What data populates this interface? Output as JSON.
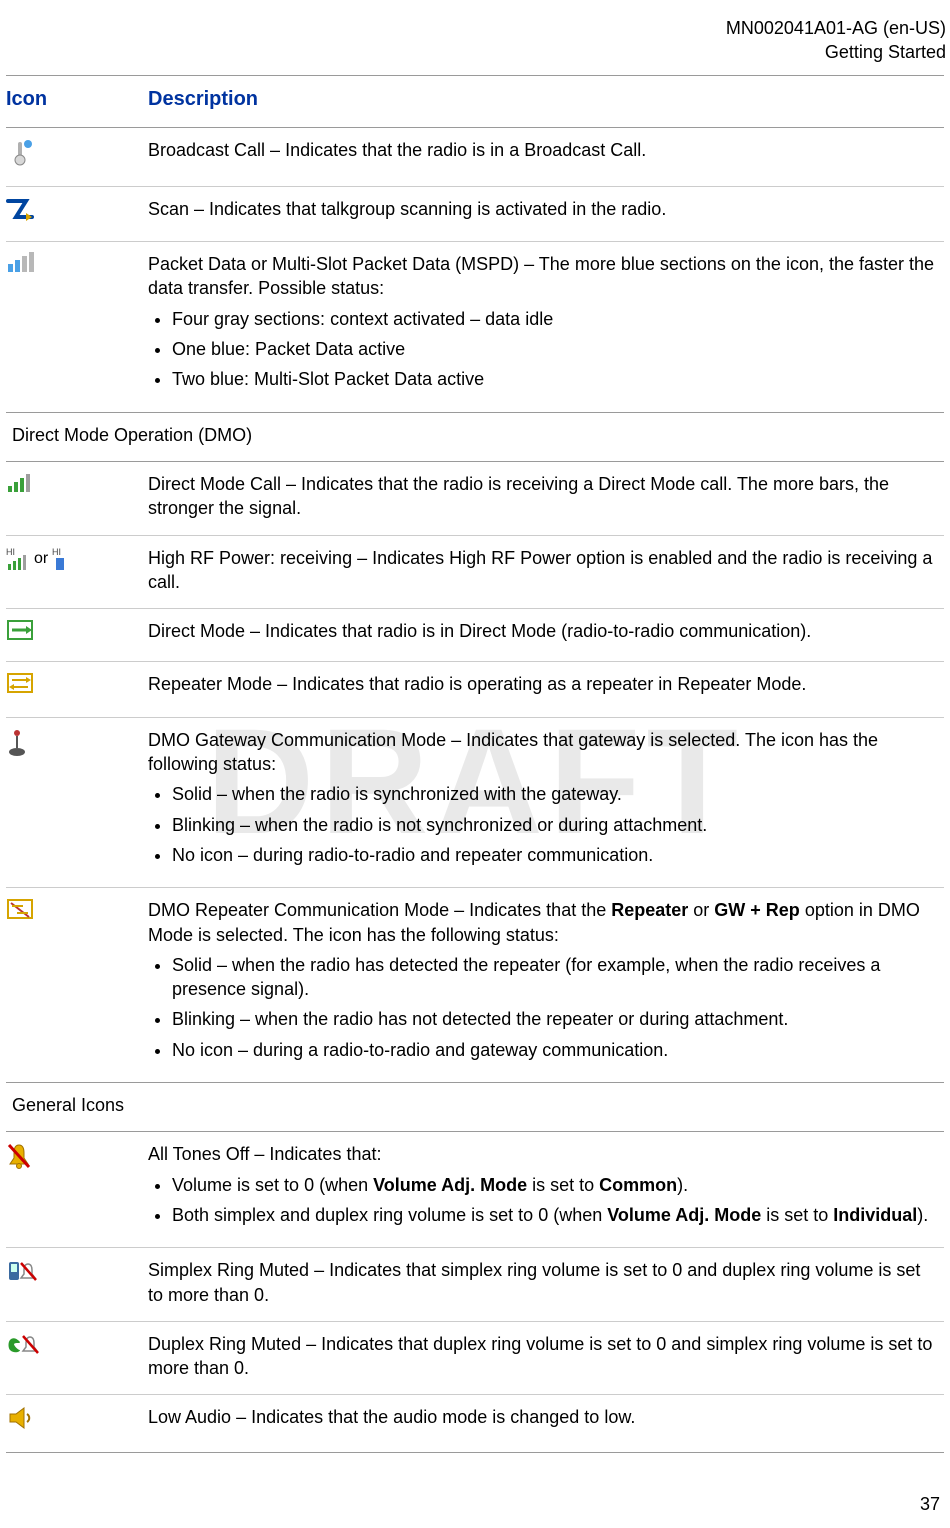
{
  "header": {
    "doc_id": "MN002041A01-AG (en-US)",
    "section": "Getting Started"
  },
  "watermark": "DRAFT",
  "columns": {
    "icon": "Icon",
    "description": "Description"
  },
  "sections": {
    "dmo": "Direct Mode Operation (DMO)",
    "general": "General Icons"
  },
  "rows": {
    "0": {
      "desc": "Broadcast Call – Indicates that the radio is in a Broadcast Call."
    },
    "1": {
      "desc": "Scan – Indicates that talkgroup scanning is activated in the radio."
    },
    "2": {
      "desc": "Packet Data or Multi-Slot Packet Data (MSPD) – The more blue sections on the icon, the faster the data transfer. Possible status:",
      "bullets": [
        "Four gray sections: context activated – data idle",
        "One blue: Packet Data active",
        "Two blue: Multi-Slot Packet Data active"
      ]
    },
    "3": {
      "desc": "Direct Mode Call – Indicates that the radio is receiving a Direct Mode call. The more bars, the stronger the signal."
    },
    "4": {
      "or": "or",
      "desc": "High RF Power: receiving – Indicates High RF Power option is enabled and the radio is receiving a call."
    },
    "5": {
      "desc": "Direct Mode – Indicates that radio is in Direct Mode (radio-to-radio communication)."
    },
    "6": {
      "desc": "Repeater Mode – Indicates that radio is operating as a repeater in Repeater Mode."
    },
    "7": {
      "desc": "DMO Gateway Communication Mode – Indicates that gateway is selected. The icon has the following status:",
      "bullets": [
        "Solid – when the radio is synchronized with the gateway.",
        "Blinking – when the radio is not synchronized or during attachment.",
        "No icon – during radio-to-radio and repeater communication."
      ]
    },
    "8": {
      "desc_part1": "DMO Repeater Communication Mode – Indicates that the ",
      "bold1": "Repeater",
      "desc_part2": " or ",
      "bold2": "GW + Rep",
      "desc_part3": " option in DMO Mode is selected. The icon has the following status:",
      "bullets": [
        "Solid – when the radio has detected the repeater (for example, when the radio receives a presence signal).",
        "Blinking – when the radio has not detected the repeater or during attachment.",
        "No icon – during a radio-to-radio and gateway communication."
      ]
    },
    "9": {
      "desc": "All Tones Off – Indicates that:",
      "bullets": {
        "0": {
          "p1": "Volume is set to 0 (when ",
          "b1": "Volume Adj. Mode",
          "p2": " is set to ",
          "b2": "Common",
          "p3": ")."
        },
        "1": {
          "p1": "Both simplex and duplex ring volume is set to 0 (when ",
          "b1": "Volume Adj. Mode",
          "p2": " is set to ",
          "b2": "Individual",
          "p3": ")."
        }
      }
    },
    "10": {
      "desc": "Simplex Ring Muted – Indicates that simplex ring volume is set to 0 and duplex ring volume is set to more than 0."
    },
    "11": {
      "desc": "Duplex Ring Muted – Indicates that duplex ring volume is set to 0 and simplex ring volume is set to more than 0."
    },
    "12": {
      "desc": "Low Audio – Indicates that the audio mode is changed to low."
    }
  },
  "page_number": "37"
}
